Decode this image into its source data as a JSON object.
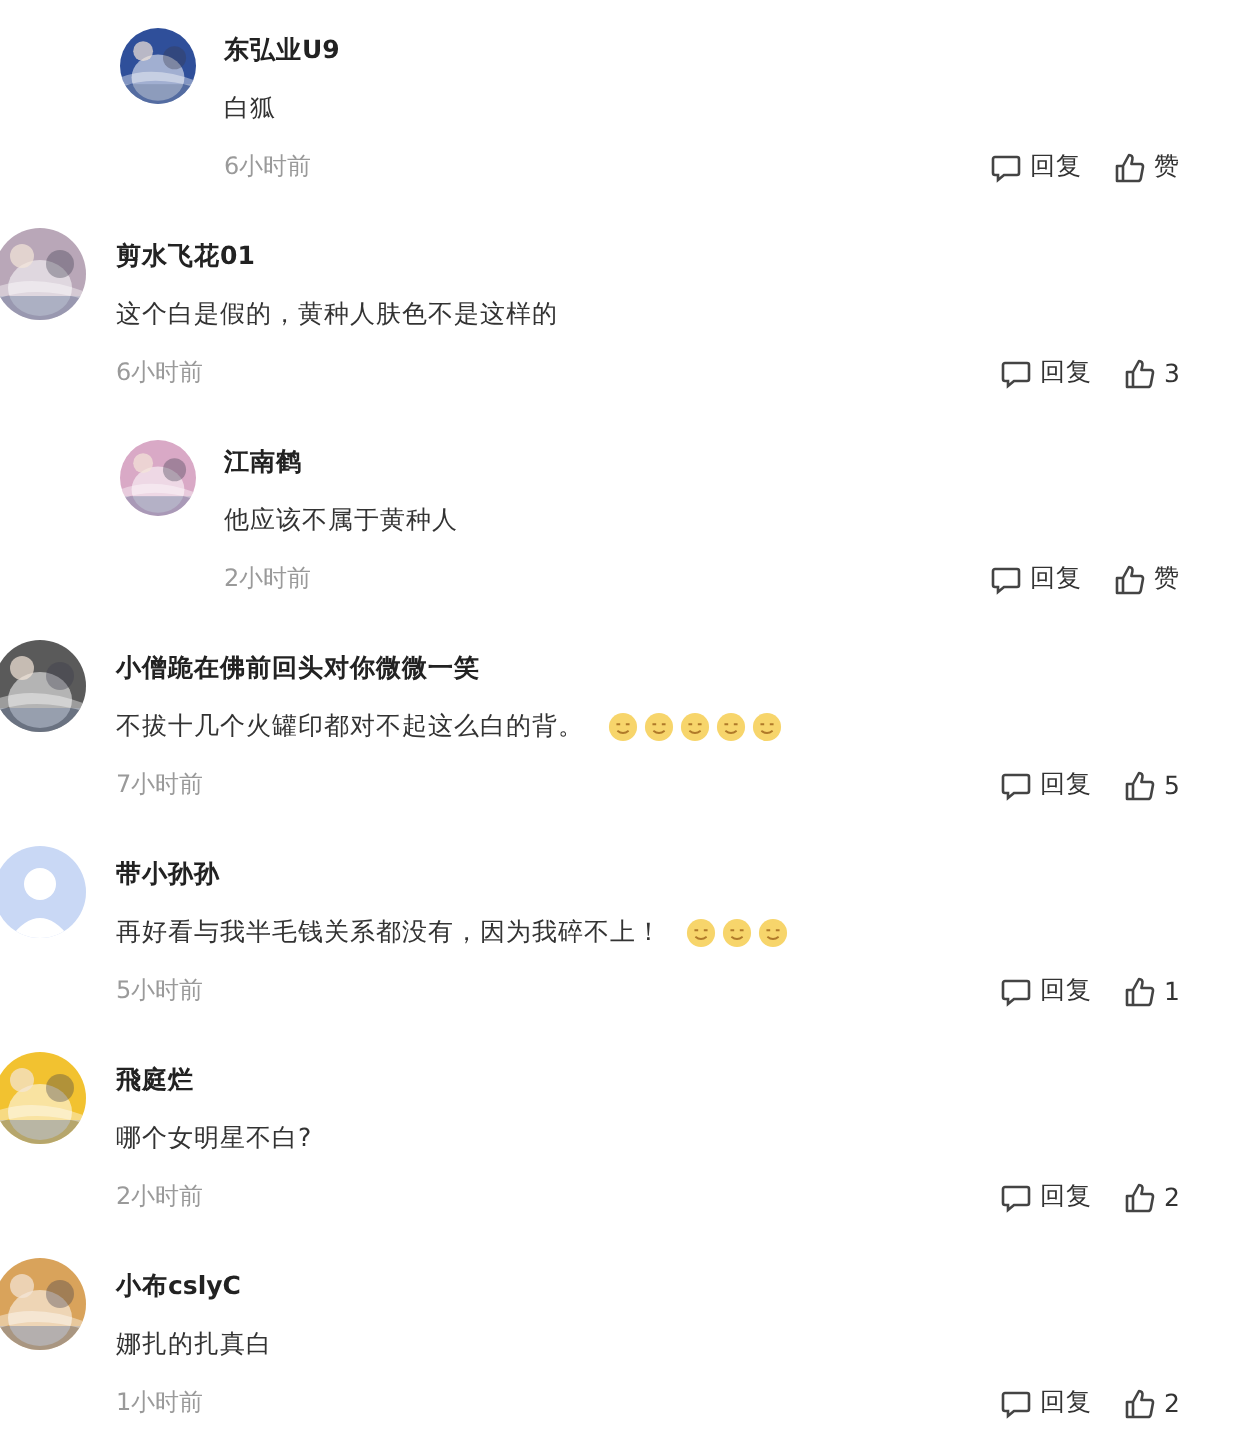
{
  "comments": [
    {
      "kind": "reply",
      "author": "东弘业U9",
      "text": "白狐",
      "time": "6小时前",
      "reply_label": "回复",
      "like_label": "赞"
    },
    {
      "kind": "comment",
      "author": "剪水飞花01",
      "text": "这个白是假的，黄种人肤色不是这样的",
      "time": "6小时前",
      "reply_label": "回复",
      "like_label": "3"
    },
    {
      "kind": "reply",
      "author": "江南鹤",
      "text": "他应该不属于黄种人",
      "time": "2小时前",
      "reply_label": "回复",
      "like_label": "赞"
    },
    {
      "kind": "comment",
      "author": "小僧跪在佛前回头对你微微一笑",
      "text": "不拔十几个火罐印都对不起这么白的背。",
      "emojis": [
        {
          "kind": "face"
        },
        {
          "kind": "face"
        },
        {
          "kind": "face"
        },
        {
          "kind": "face"
        },
        {
          "kind": "face"
        }
      ],
      "time": "7小时前",
      "reply_label": "回复",
      "like_label": "5"
    },
    {
      "kind": "comment",
      "avatar": {
        "kind": "default",
        "color": "#c9d8f5"
      },
      "author": "带小孙孙",
      "text": "再好看与我半毛钱关系都没有，因为我碎不上！",
      "emojis": [
        {
          "kind": "face"
        },
        {
          "kind": "face"
        },
        {
          "kind": "face"
        }
      ],
      "time": "5小时前",
      "reply_label": "回复",
      "like_label": "1"
    },
    {
      "kind": "comment",
      "author": "飛庭烂",
      "text": "哪个女明星不白?",
      "time": "2小时前",
      "reply_label": "回复",
      "like_label": "2"
    },
    {
      "kind": "comment",
      "author": "小布cslyC",
      "text": "娜扎的扎真白",
      "time": "1小时前",
      "reply_label": "回复",
      "like_label": "2"
    }
  ]
}
